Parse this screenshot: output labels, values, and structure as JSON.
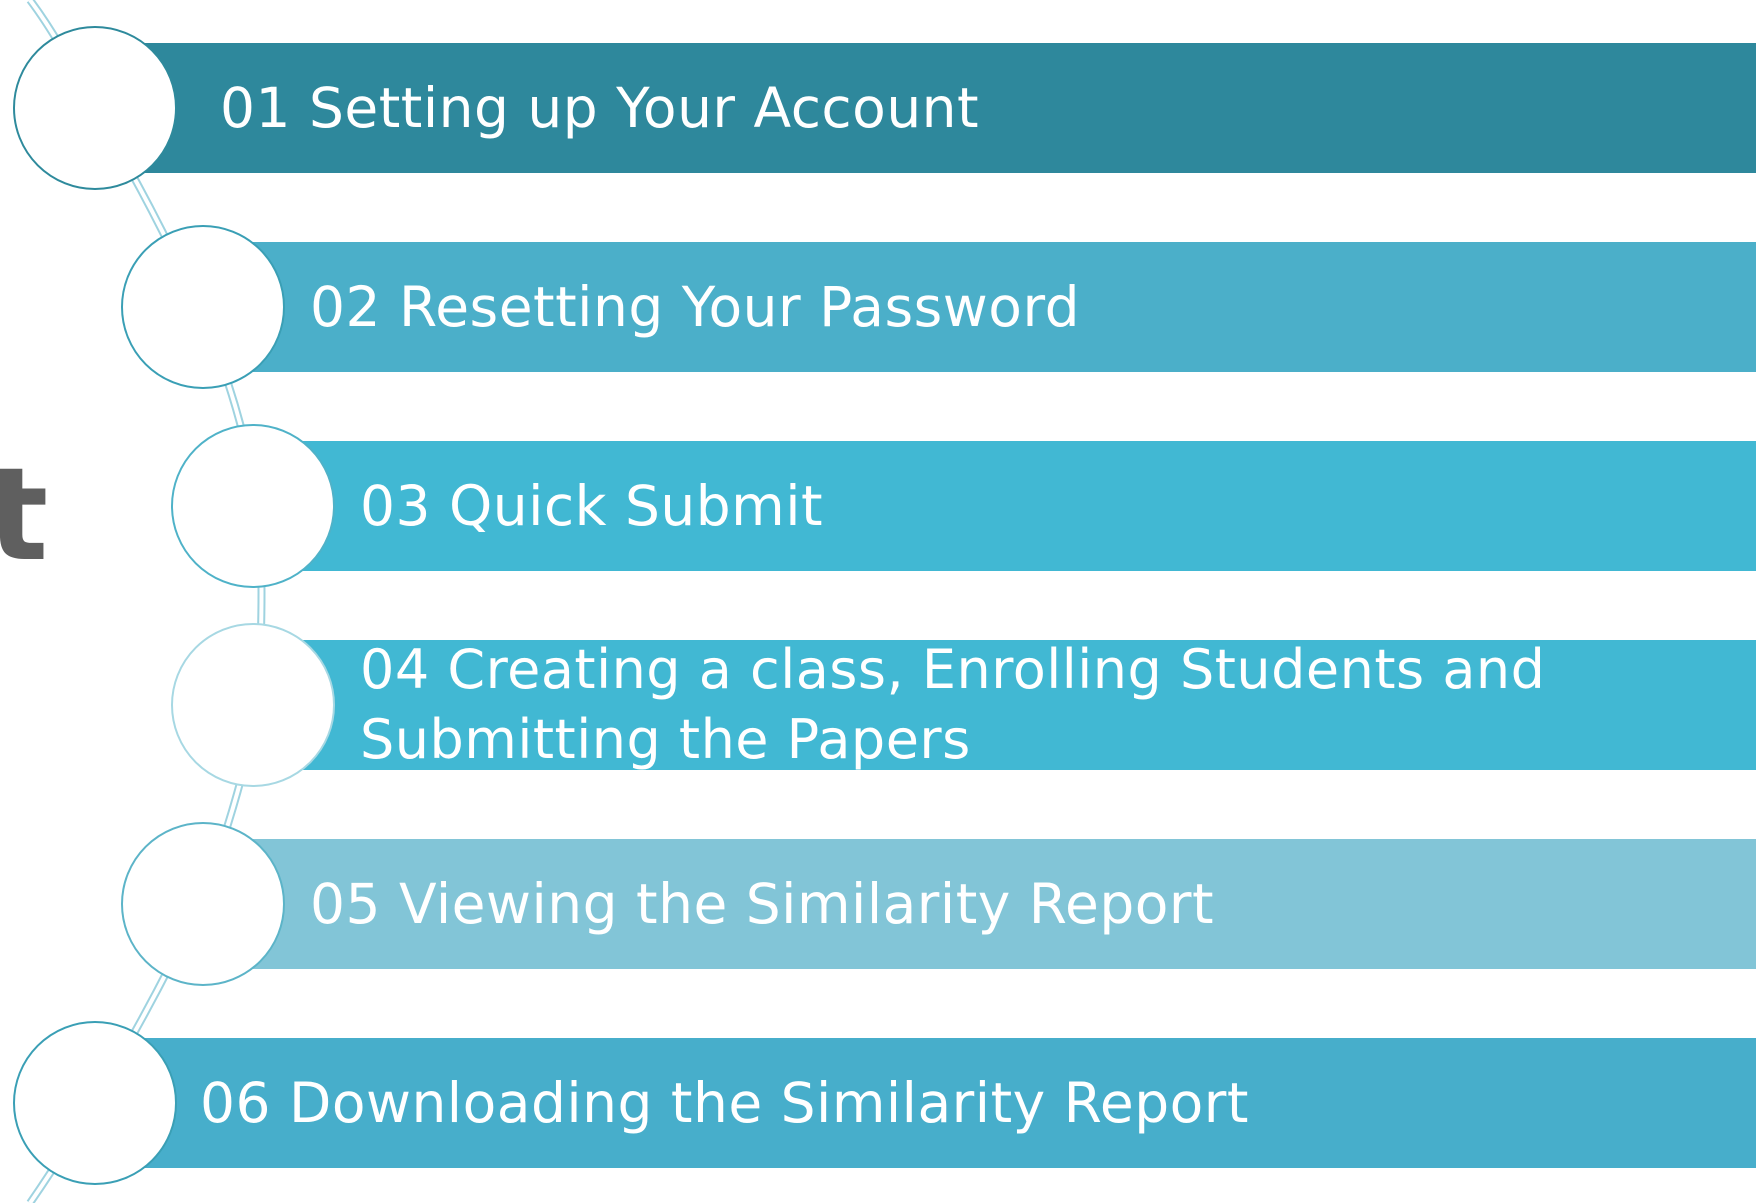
{
  "title_fragment": "rt",
  "colors": {
    "band_1": "#2e889c",
    "band_2": "#4bafc9",
    "band_3": "#41b8d3",
    "band_4": "#41b8d3",
    "band_5": "#82c5d7",
    "band_6": "#47aecb",
    "circle_border": "#2e8a9c",
    "connector": "#6fbfd1",
    "title": "#5f5f5f"
  },
  "steps": [
    {
      "label": "01 Setting up Your Account"
    },
    {
      "label": "02 Resetting Your Password"
    },
    {
      "label": "03 Quick Submit"
    },
    {
      "label": "04 Creating a class, Enrolling Students and Submitting the Papers"
    },
    {
      "label": "05 Viewing the Similarity Report"
    },
    {
      "label": "06 Downloading the Similarity Report"
    }
  ]
}
